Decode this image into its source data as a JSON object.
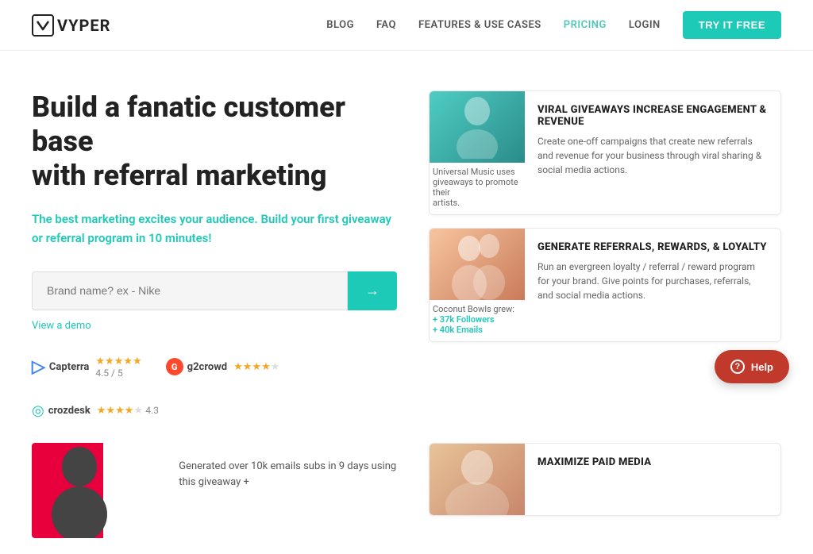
{
  "nav": {
    "logo_text": "VYPER",
    "links": [
      {
        "label": "BLOG",
        "id": "blog"
      },
      {
        "label": "FAQ",
        "id": "faq"
      },
      {
        "label": "FEATURES & USE CASES",
        "id": "features"
      },
      {
        "label": "PRICING",
        "id": "pricing"
      },
      {
        "label": "LOGIN",
        "id": "login"
      }
    ],
    "cta_label": "TRY IT FREE"
  },
  "hero": {
    "title_line1": "Build a fanatic customer base",
    "title_line2": "with referral marketing",
    "subtitle_before": "The best marketing excites your audience. Build your first giveaway or referral program in ",
    "subtitle_highlight": "10",
    "subtitle_after": " minutes!",
    "input_placeholder": "Brand name? ex - Nike",
    "view_demo": "View a demo",
    "arrow": "→"
  },
  "ratings": [
    {
      "id": "capterra",
      "name": "Capterra",
      "icon_label": "▶",
      "stars": "★★★★★",
      "score": "4.5 / 5"
    },
    {
      "id": "g2crowd",
      "name": "g2crowd",
      "icon_label": "G",
      "stars": "★★★★½",
      "score": ""
    },
    {
      "id": "crozdesk",
      "name": "crozdesk",
      "icon_label": "©",
      "stars": "★★★★",
      "score": "4.3"
    }
  ],
  "cards": [
    {
      "id": "card-giveaways",
      "img_caption_1": "Universal Music uses",
      "img_caption_2": "giveaways to promote their",
      "img_caption_3": "artists.",
      "title": "VIRAL GIVEAWAYS INCREASE ENGAGEMENT & REVENUE",
      "desc": "Create one-off campaigns that create new referrals and revenue for your business through viral sharing & social media actions."
    },
    {
      "id": "card-referrals",
      "img_caption_1": "Coconut Bowls grew:",
      "img_caption_2": "+ 37k Followers",
      "img_caption_3": "+ 40k Emails",
      "title": "GENERATE REFERRALS, REWARDS, & LOYALTY",
      "desc": "Run an evergreen loyalty / referral / reward program for your brand. Give points for purchases, referrals, and social media actions."
    }
  ],
  "bottom": {
    "caption": "Generated over 10k emails subs in 9 days using this giveaway +",
    "card_title": "MAXIMIZE PAID MEDIA"
  },
  "help": {
    "label": "Help",
    "icon": "?"
  }
}
